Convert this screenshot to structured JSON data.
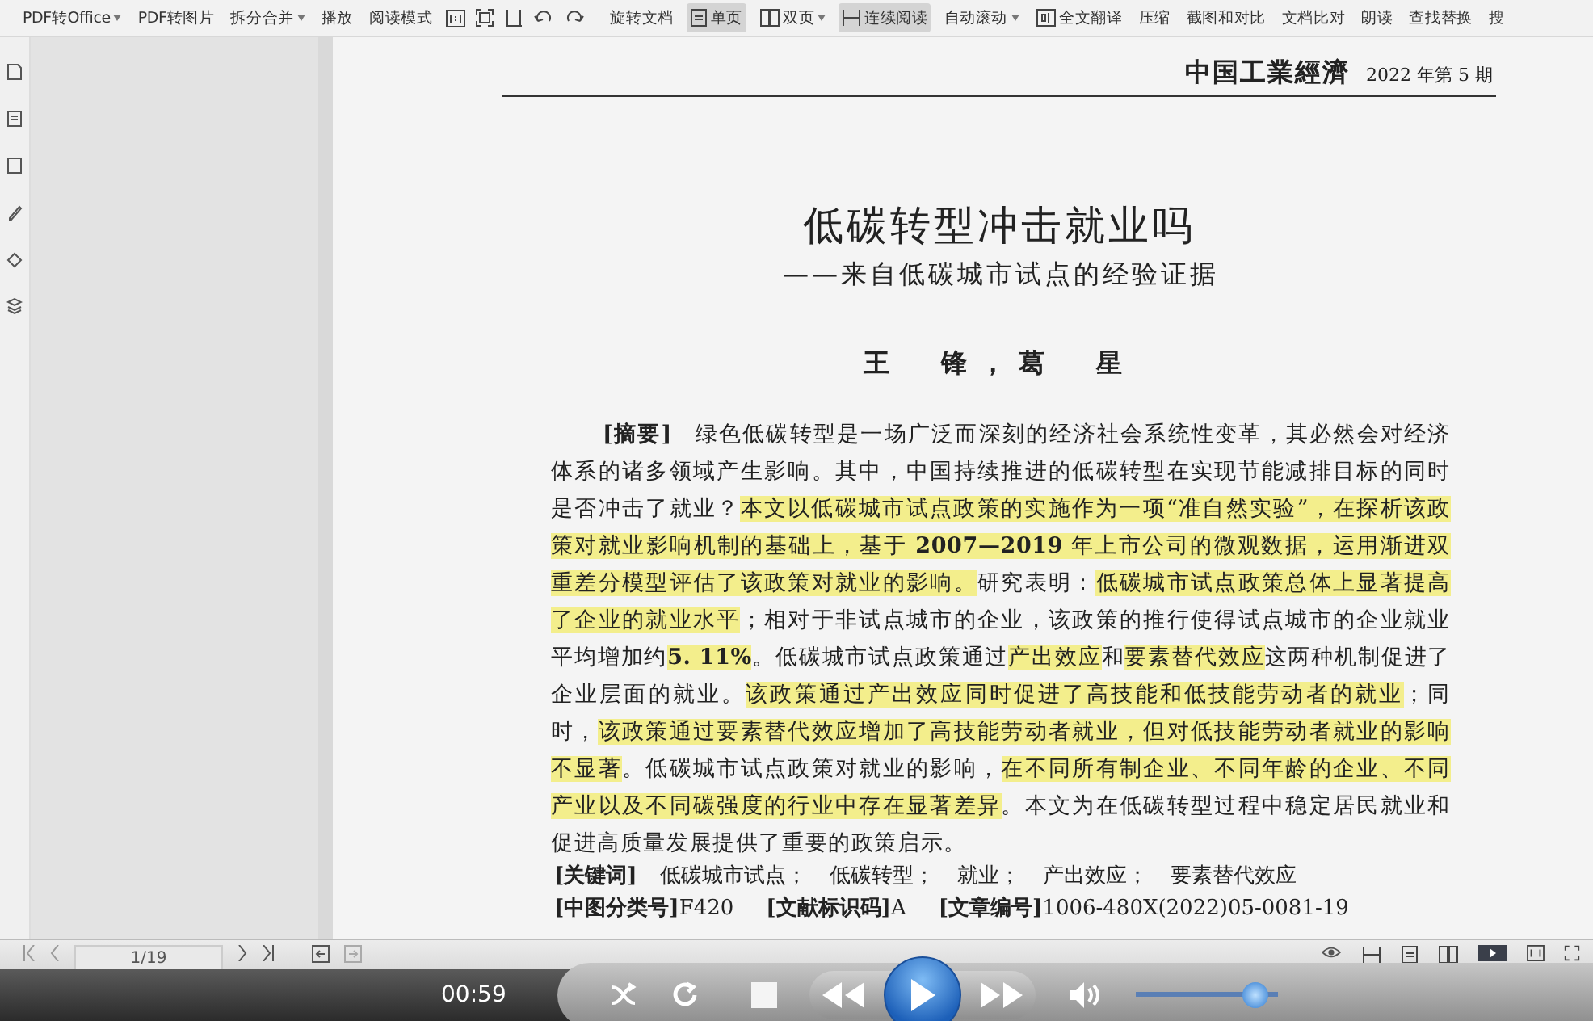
{
  "toolbar": {
    "left_items": [
      {
        "label": "PDF转Office",
        "dropdown": true
      },
      {
        "label": "PDF转图片",
        "dropdown": false
      },
      {
        "label": "拆分合并",
        "dropdown": true
      },
      {
        "label": "播放",
        "dropdown": false
      },
      {
        "label": "阅读模式",
        "dropdown": false
      }
    ],
    "rotate_label": "旋转文档",
    "view_items": [
      {
        "label": "单页",
        "kind": "single-page",
        "dropdown": false,
        "selected": true
      },
      {
        "label": "双页",
        "kind": "two-page",
        "dropdown": true,
        "selected": false
      },
      {
        "label": "连续阅读",
        "kind": "continuous",
        "dropdown": false,
        "selected": true
      },
      {
        "label": "自动滚动",
        "kind": "plain",
        "dropdown": true,
        "selected": false
      },
      {
        "label": "全文翻译",
        "kind": "translate",
        "dropdown": false,
        "selected": false
      }
    ],
    "tool_items": [
      "压缩",
      "截图和对比",
      "文档比对",
      "朗读",
      "查找替换",
      "搜"
    ]
  },
  "document": {
    "journal": "中国工業經濟",
    "issue": "2022 年第 5 期",
    "title": "低碳转型冲击就业吗",
    "subtitle": "——来自低碳城市试点的经验证据",
    "authors": "王　锋，葛　星",
    "abstract": {
      "label": "[摘要]",
      "segments": [
        {
          "text": "绿色低碳转型是一场广泛而深刻的经济社会系统性变革，其必然会对经济体系的诸多领域产生影响。其中，中国持续推进的低碳转型在实现节能减排目标的同时是否冲击了就业？",
          "highlighted": false
        },
        {
          "text": "本文以低碳城市试点政策的实施作为一项“准自然实验”，在探析该政策对就业影响机制的基础上，基于 **2007—2019** 年上市公司的微观数据，运用渐进双重差分模型评估了该政策对就业的影响。",
          "highlighted": true
        },
        {
          "text": "研究表明：",
          "highlighted": false
        },
        {
          "text": "低碳城市试点政策总体上显著提高了企业的就业水平",
          "highlighted": true
        },
        {
          "text": "；相对于非试点城市的企业，该政策的推行使得试点城市的企业就业平均增加约",
          "highlighted": false
        },
        {
          "text": "**5. 11%**",
          "highlighted": true
        },
        {
          "text": "。低碳城市试点政策通过",
          "highlighted": false
        },
        {
          "text": "产出效应",
          "highlighted": true
        },
        {
          "text": "和",
          "highlighted": false
        },
        {
          "text": "要素替代效应",
          "highlighted": true
        },
        {
          "text": "这两种机制促进了企业层面的就业。",
          "highlighted": false
        },
        {
          "text": "该政策通过产出效应同时促进了高技能和低技能劳动者的就业",
          "highlighted": true
        },
        {
          "text": "；同时，",
          "highlighted": false
        },
        {
          "text": "该政策通过要素替代效应增加了高技能劳动者就业，但对低技能劳动者就业的影响不显著",
          "highlighted": true
        },
        {
          "text": "。低碳城市试点政策对就业的影响，",
          "highlighted": false
        },
        {
          "text": "在不同所有制企业、不同年龄的企业、不同产业以及不同碳强度的行业中存在显著差异",
          "highlighted": true
        },
        {
          "text": "。本文为在低碳转型过程中稳定居民就业和促进高质量发展提供了重要的政策启示。",
          "highlighted": false
        }
      ]
    },
    "keywords": {
      "label": "[关键词]",
      "items": [
        "低碳城市试点；",
        "低碳转型；",
        "就业；",
        "产出效应；",
        "要素替代效应"
      ]
    },
    "classification": [
      {
        "label": "[中图分类号]",
        "value": "F420"
      },
      {
        "label": "[文献标识码]",
        "value": "A"
      },
      {
        "label": "[文章编号]",
        "value": "1006-480X(2022)05-0081-19"
      }
    ]
  },
  "page_nav": {
    "page": "1/19"
  },
  "player": {
    "time": "00:59",
    "volume": {
      "level": 0.92
    }
  }
}
